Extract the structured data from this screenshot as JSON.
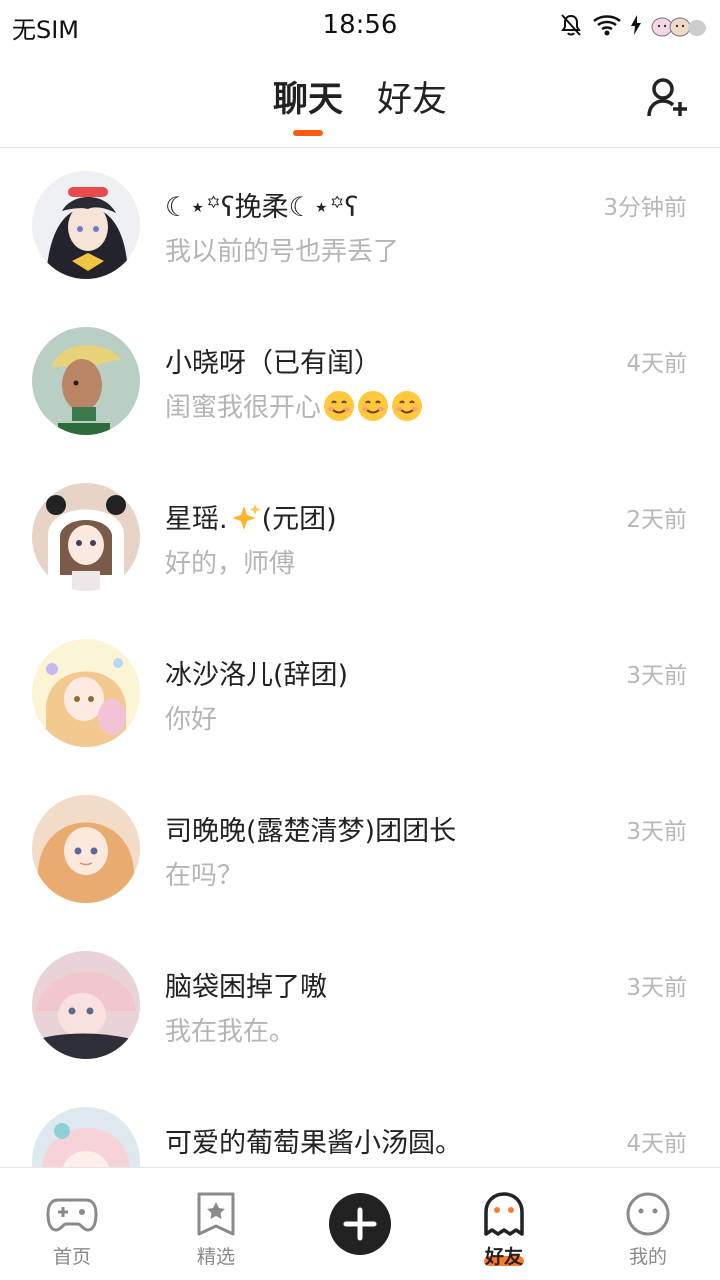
{
  "status_bar": {
    "carrier": "无SIM",
    "time": "18:56",
    "icons": [
      "mute-bell-icon",
      "wifi-icon",
      "charging-icon",
      "battery-face-icon"
    ]
  },
  "header": {
    "tabs": [
      {
        "label": "聊天",
        "active": true
      },
      {
        "label": "好友",
        "active": false
      }
    ],
    "add_friend_icon": "add-user-icon",
    "accent_color": "#ff5a14"
  },
  "chats": [
    {
      "name": "☾⋆꙳ʕ挽柔☾⋆꙳ʕ",
      "preview": "我以前的号也弄丢了",
      "time": "3分钟前"
    },
    {
      "name": "小晓呀（已有闺）",
      "preview": "闺蜜我很开心",
      "preview_emojis": [
        "smile-emoji",
        "smile-emoji",
        "smile-emoji"
      ],
      "time": "4天前"
    },
    {
      "name_prefix": "星瑶.",
      "name_emoji": "sparkles-emoji",
      "name_suffix": "(元团)",
      "preview": "好的，师傅",
      "time": "2天前"
    },
    {
      "name": "冰沙洛儿(辞团)",
      "preview": "你好",
      "time": "3天前"
    },
    {
      "name": "司晚晚(露楚清梦)团团长",
      "preview": "在吗？",
      "time": "3天前"
    },
    {
      "name": "脑袋困掉了嗷",
      "preview": "我在我在。",
      "time": "3天前"
    },
    {
      "name": "可爱的葡萄果酱小汤圆。",
      "preview": "",
      "time": "4天前"
    }
  ],
  "bottom_nav": {
    "items": [
      {
        "label": "首页",
        "icon": "gamepad-icon",
        "active": false
      },
      {
        "label": "精选",
        "icon": "star-bookmark-icon",
        "active": false
      },
      {
        "label": "好友",
        "icon": "ghost-icon",
        "active": true
      },
      {
        "label": "我的",
        "icon": "smiley-face-icon",
        "active": false
      }
    ],
    "center_button_icon": "plus-icon"
  }
}
